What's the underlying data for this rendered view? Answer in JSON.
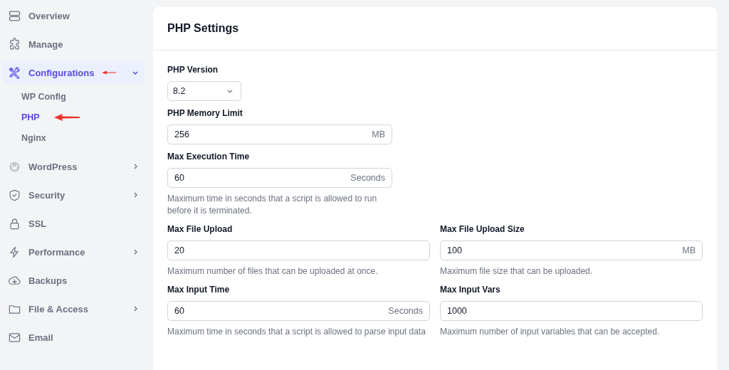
{
  "sidebar": {
    "items": [
      {
        "label": "Overview",
        "selected": false
      },
      {
        "label": "Manage",
        "selected": false
      },
      {
        "label": "Configurations",
        "selected": true,
        "expanded": true,
        "children": [
          {
            "label": "WP Config",
            "selected": false
          },
          {
            "label": "PHP",
            "selected": true
          },
          {
            "label": "Nginx",
            "selected": false
          }
        ]
      },
      {
        "label": "WordPress",
        "selected": false,
        "expanded": false
      },
      {
        "label": "Security",
        "selected": false,
        "expanded": false
      },
      {
        "label": "SSL",
        "selected": false
      },
      {
        "label": "Performance",
        "selected": false,
        "expanded": false
      },
      {
        "label": "Backups",
        "selected": false
      },
      {
        "label": "File & Access",
        "selected": false,
        "expanded": false
      },
      {
        "label": "Email",
        "selected": false
      }
    ]
  },
  "panel": {
    "title": "PHP Settings",
    "single_fields": [
      {
        "kind": "select",
        "label": "PHP Version",
        "value": "8.2"
      },
      {
        "kind": "input",
        "label": "PHP Memory Limit",
        "value": "256",
        "unit": "MB"
      },
      {
        "kind": "input",
        "label": "Max Execution Time",
        "value": "60",
        "unit": "Seconds",
        "help": "Maximum time in seconds that a script is allowed to run before it is terminated."
      }
    ],
    "grid_fields": [
      {
        "kind": "input",
        "label": "Max File Upload",
        "value": "20",
        "help": "Maximum number of files that can be uploaded at once."
      },
      {
        "kind": "input",
        "label": "Max File Upload Size",
        "value": "100",
        "unit": "MB",
        "help": "Maximum file size that can be uploaded."
      },
      {
        "kind": "input",
        "label": "Max Input Time",
        "value": "60",
        "unit": "Seconds",
        "help": "Maximum time in seconds that a script is allowed to parse input data"
      },
      {
        "kind": "input",
        "label": "Max Input Vars",
        "value": "1000",
        "help": "Maximum number of input variables that can be accepted."
      }
    ]
  }
}
